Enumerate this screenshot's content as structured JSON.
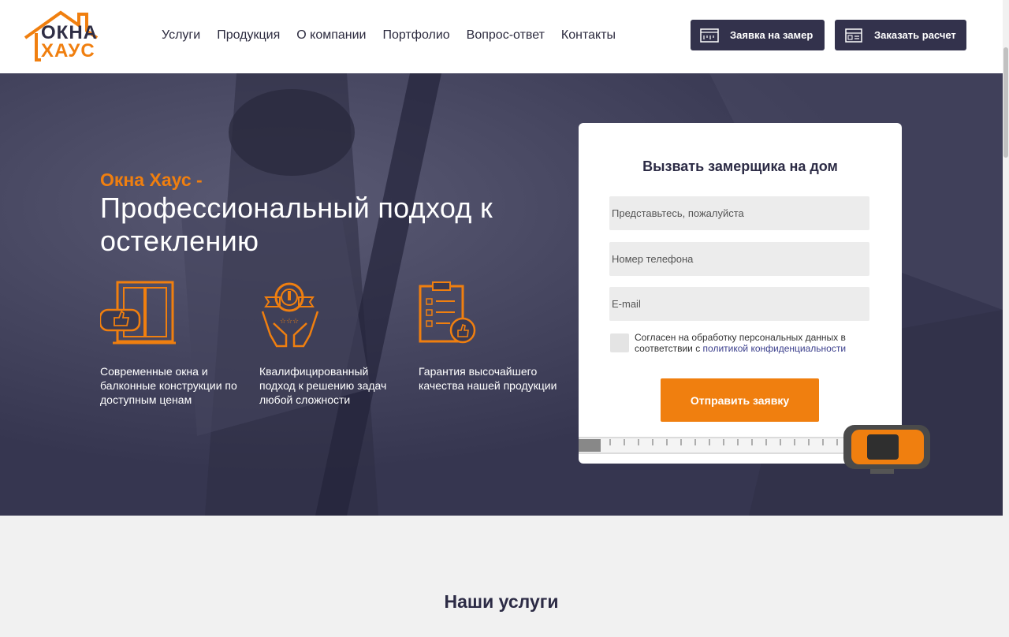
{
  "header": {
    "logo": {
      "line1": "ОКНА",
      "line2": "ХАУС"
    },
    "nav": [
      "Услуги",
      "Продукция",
      "О компании",
      "Портфолио",
      "Вопрос-ответ",
      "Контакты"
    ],
    "btn_measure": "Заявка на замер",
    "btn_calc": "Заказать расчет"
  },
  "hero": {
    "brand": "Окна Хаус -",
    "title": "Профессиональный подход к остеклению",
    "features": [
      {
        "icon": "window-thumbs-up-icon",
        "text": "Современные окна и балконные конструкции по доступным ценам"
      },
      {
        "icon": "hands-medal-icon",
        "text": "Квалифицированный подход к решению задач любой сложности"
      },
      {
        "icon": "clipboard-checklist-icon",
        "text": "Гарантия высочайшего качества нашей продукции"
      }
    ]
  },
  "form": {
    "title": "Вызвать замерщика на дом",
    "name_placeholder": "Представьтесь, пожалуйста",
    "phone_placeholder": "Номер телефона",
    "email_placeholder": "E-mail",
    "consent_text": "Согласен на обработку персональных данных в соответствии с ",
    "consent_link": "политикой конфиденциальности",
    "submit": "Отправить заявку"
  },
  "services": {
    "title": "Наши услуги"
  },
  "colors": {
    "accent": "#f07f0f",
    "dark": "#33324c",
    "hero_bg": "#3a3a52"
  }
}
